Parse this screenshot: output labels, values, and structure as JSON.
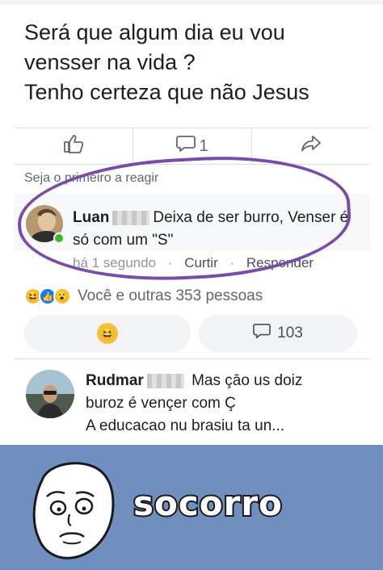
{
  "post": {
    "line1": "Será que algum dia eu vou",
    "line2": "vensser na vida ?",
    "line3": "Tenho certeza que não Jesus"
  },
  "actions": {
    "comment_count": "1"
  },
  "be_first": "Seja o primeiro a reagir",
  "comment1": {
    "author": "Luan",
    "text_part1": "Deixa de ser burro, Venser é",
    "text_part2": "só com um \"S\"",
    "time": "há 1 segundo",
    "like": "Curtir",
    "reply": "Responder"
  },
  "reactions": {
    "summary": "Você e outras 353 pessoas"
  },
  "comment_count_pill": "103",
  "comment2": {
    "author": "Rudmar",
    "text_part1": "Mas çāo us doiz",
    "line2": "buroz é vençer com Ç",
    "line3": "A educacao nu brasiu ta un..."
  },
  "meme": {
    "caption": "socorro"
  },
  "colors": {
    "circle": "#7a4ca8",
    "meme_bg": "#6f8fc1",
    "like_blue": "#1877f2"
  }
}
